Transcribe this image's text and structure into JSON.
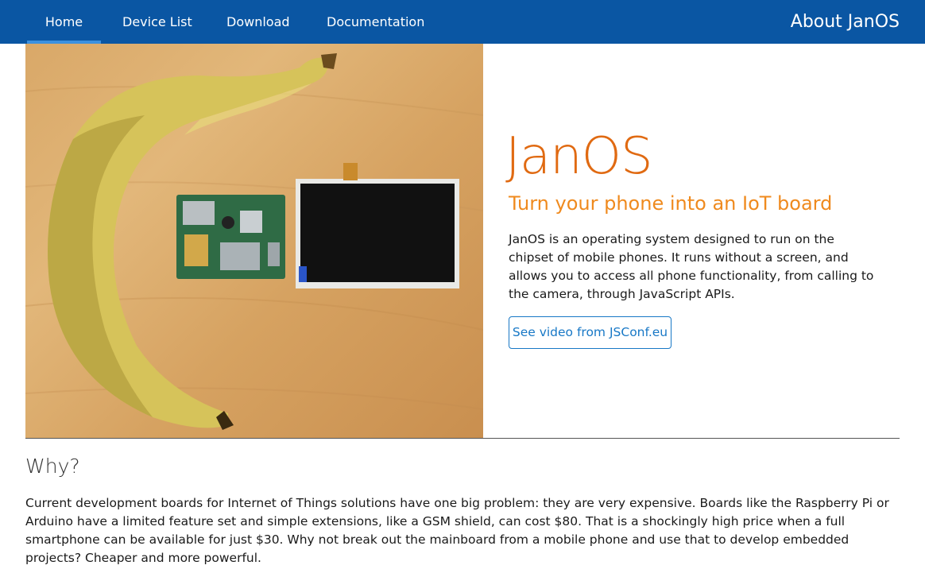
{
  "nav": {
    "items": [
      {
        "label": "Home",
        "active": true
      },
      {
        "label": "Device List",
        "active": false
      },
      {
        "label": "Download",
        "active": false
      },
      {
        "label": "Documentation",
        "active": false
      }
    ],
    "about_label": "About JanOS"
  },
  "hero": {
    "title": "JanOS",
    "subtitle": "Turn your phone into an IoT board",
    "description": "JanOS is an operating system designed to run on the chipset of mobile phones. It runs without a screen, and allows you to access all phone functionality, from calling to the camera, through JavaScript APIs.",
    "video_button_label": "See video from JSConf.eu",
    "photo_alt": "banana-mainboard-screen-photo"
  },
  "why": {
    "heading": "Why?",
    "text": "Current development boards for Internet of Things solutions have one big problem: they are very expensive. Boards like the Raspberry Pi or Arduino have a limited feature set and simple extensions, like a GSM shield, can cost $80. That is a shockingly high price when a full smartphone can be available for just $30. Why not break out the mainboard from a mobile phone and use that to develop embedded projects? Cheaper and more powerful."
  },
  "colors": {
    "navbar": "#0a56a3",
    "accent_orange": "#e06a12",
    "subtitle_orange": "#ef8a1e",
    "button_blue": "#1878c6"
  }
}
